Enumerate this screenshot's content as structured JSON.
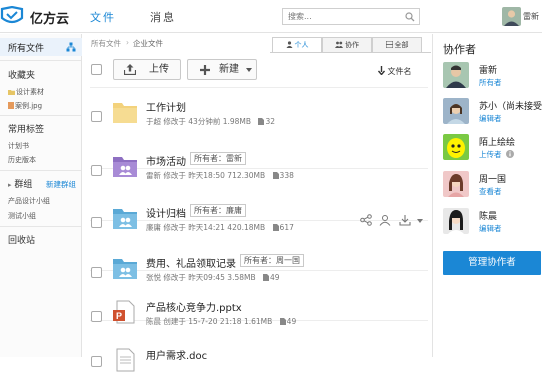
{
  "app": {
    "name": "亿方云",
    "tabs": [
      {
        "label": "文件",
        "active": true
      },
      {
        "label": "消息",
        "active": false
      }
    ],
    "search_placeholder": "搜索...",
    "user_name": "雷新",
    "accent_color": "#1b87d5"
  },
  "sidebar": {
    "all_files": "所有文件",
    "favorites": {
      "label": "收藏夹",
      "items": [
        "设计素材",
        "案例.jpg"
      ]
    },
    "tags": {
      "label": "常用标签",
      "items": [
        "计划书",
        "历史版本"
      ]
    },
    "groups": {
      "label": "群组",
      "new_link": "新建群组",
      "items": [
        "产品设计小组",
        "测试小组"
      ]
    },
    "recycle": "回收站"
  },
  "main": {
    "breadcrumb": [
      "所有文件",
      "企业文件"
    ],
    "view_tabs": [
      "个人",
      "协作",
      "全部"
    ],
    "upload_label": "上传",
    "new_label": "新建",
    "sort_label": "文件名",
    "files": [
      {
        "name": "工作计划",
        "type": "folder",
        "owner": "",
        "owner_tag": "",
        "user": "于超",
        "verb": "修改于",
        "time": "43分钟前",
        "size": "1.98MB",
        "count": "32"
      },
      {
        "name": "市场活动",
        "type": "folder-shared",
        "owner": "所有者：雷新",
        "user": "雷新",
        "verb": "修改于",
        "time": "昨天18:50",
        "size": "712.30MB",
        "count": "338"
      },
      {
        "name": "设计归档",
        "type": "folder-shared",
        "owner": "所有者：廉庸",
        "user": "廉庸",
        "verb": "修改于",
        "time": "昨天14:21",
        "size": "420.18MB",
        "count": "617"
      },
      {
        "name": "费用、礼品领取记录",
        "type": "folder-shared",
        "owner": "所有者：周一国",
        "user": "张悦",
        "verb": "修改于",
        "time": "昨天09:45",
        "size": "3.58MB",
        "count": "49"
      },
      {
        "name": "产品核心竞争力.pptx",
        "type": "pptx",
        "owner": "",
        "user": "陈晨",
        "verb": "创建于",
        "time": "15-7-20 21:18",
        "size": "1.61MB",
        "count": "49"
      },
      {
        "name": "用户需求.doc",
        "type": "doc",
        "owner": "",
        "user": "",
        "verb": "",
        "time": "",
        "size": "",
        "count": ""
      }
    ]
  },
  "collaborators": {
    "title": "协作者",
    "list": [
      {
        "name": "雷新",
        "role": "所有者"
      },
      {
        "name": "苏小（尚未接受",
        "role": "编辑者"
      },
      {
        "name": "陌上绘绘",
        "role": "上传者"
      },
      {
        "name": "周一国",
        "role": "查看者"
      },
      {
        "name": "陈晨",
        "role": "编辑者"
      }
    ],
    "manage_label": "管理协作者"
  }
}
